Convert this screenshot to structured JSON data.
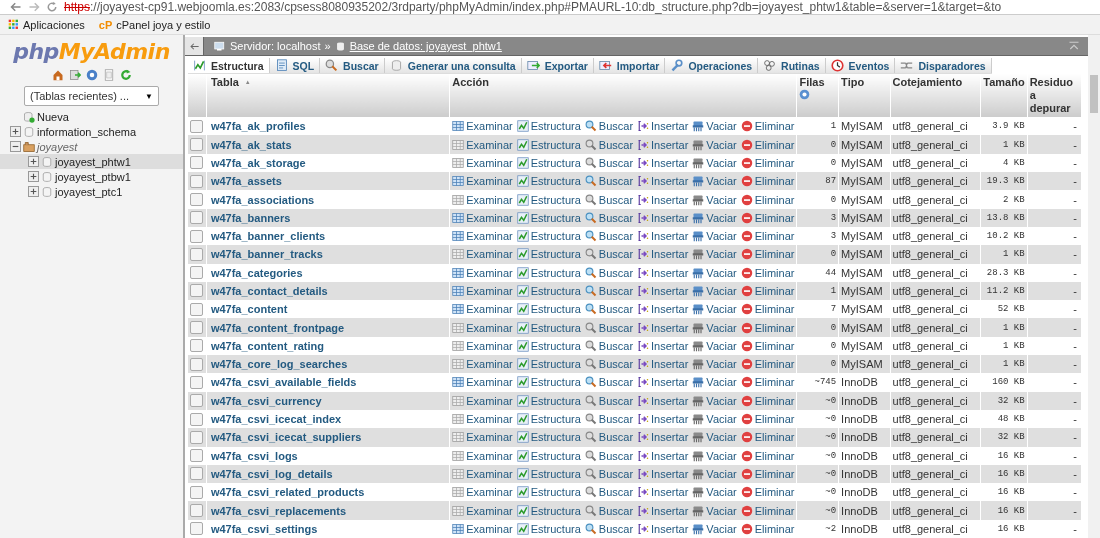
{
  "browser": {
    "url_scheme": "https",
    "url_rest": "://joyayest-cp91.webjoomla.es:2083/cpsess8080935202/3rdparty/phpMyAdmin/index.php#PMAURL-10:db_structure.php?db=joyayest_phtw1&table=&server=1&target=&to",
    "bookmarks": [
      {
        "kind": "apps",
        "label": "Aplicaciones"
      },
      {
        "kind": "cpanel",
        "badge": "cP",
        "label": "cPanel joya y estilo"
      }
    ]
  },
  "sidebar": {
    "logo_prefix": "php",
    "logo_name": "MyAdmin",
    "recent_tables": "(Tablas recientes) ...",
    "select_caret": "▼",
    "tree": [
      {
        "kind": "new",
        "label": "Nueva",
        "selected": false
      },
      {
        "kind": "db",
        "label": "information_schema",
        "expanded": false,
        "selected": false
      },
      {
        "kind": "group",
        "label": "joyayest",
        "expanded": true,
        "selected": false,
        "children": [
          {
            "kind": "db",
            "label": "joyayest_phtw1",
            "expanded": false,
            "selected": true
          },
          {
            "kind": "db",
            "label": "joyayest_ptbw1",
            "expanded": false,
            "selected": false
          },
          {
            "kind": "db",
            "label": "joyayest_ptc1",
            "expanded": false,
            "selected": false
          }
        ]
      }
    ]
  },
  "breadcrumb": {
    "server": "Servidor: localhost",
    "separator": "»",
    "database": "Base de datos: joyayest_phtw1"
  },
  "tabs": [
    {
      "label": "Estructura",
      "selected": true
    },
    {
      "label": "SQL",
      "selected": false
    },
    {
      "label": "Buscar",
      "selected": false
    },
    {
      "label": "Generar una consulta",
      "selected": false
    },
    {
      "label": "Exportar",
      "selected": false
    },
    {
      "label": "Importar",
      "selected": false
    },
    {
      "label": "Operaciones",
      "selected": false
    },
    {
      "label": "Rutinas",
      "selected": false
    },
    {
      "label": "Eventos",
      "selected": false
    },
    {
      "label": "Disparadores",
      "selected": false
    }
  ],
  "table": {
    "columns": [
      "Tabla",
      "Acción",
      "Filas",
      "Tipo",
      "Cotejamiento",
      "Tamaño",
      "Residuo a depurar"
    ],
    "sort_arrow": "▲",
    "rows": [
      {
        "name": "w47fa_ak_profiles",
        "checked": false,
        "empty": false,
        "actions": [
          "Examinar",
          "Estructura",
          "Buscar",
          "Insertar",
          "Vaciar",
          "Eliminar"
        ],
        "rows": "1",
        "type": "MyISAM",
        "collation": "utf8_general_ci",
        "size": "3.9 KB",
        "overhead": "-"
      },
      {
        "name": "w47fa_ak_stats",
        "checked": false,
        "empty": true,
        "actions": [
          "Examinar",
          "Estructura",
          "Buscar",
          "Insertar",
          "Vaciar",
          "Eliminar"
        ],
        "rows": "0",
        "type": "MyISAM",
        "collation": "utf8_general_ci",
        "size": "1 KB",
        "overhead": "-"
      },
      {
        "name": "w47fa_ak_storage",
        "checked": false,
        "empty": true,
        "actions": [
          "Examinar",
          "Estructura",
          "Buscar",
          "Insertar",
          "Vaciar",
          "Eliminar"
        ],
        "rows": "0",
        "type": "MyISAM",
        "collation": "utf8_general_ci",
        "size": "4 KB",
        "overhead": "-"
      },
      {
        "name": "w47fa_assets",
        "checked": false,
        "empty": false,
        "actions": [
          "Examinar",
          "Estructura",
          "Buscar",
          "Insertar",
          "Vaciar",
          "Eliminar"
        ],
        "rows": "87",
        "type": "MyISAM",
        "collation": "utf8_general_ci",
        "size": "19.3 KB",
        "overhead": "-"
      },
      {
        "name": "w47fa_associations",
        "checked": false,
        "empty": true,
        "actions": [
          "Examinar",
          "Estructura",
          "Buscar",
          "Insertar",
          "Vaciar",
          "Eliminar"
        ],
        "rows": "0",
        "type": "MyISAM",
        "collation": "utf8_general_ci",
        "size": "2 KB",
        "overhead": "-"
      },
      {
        "name": "w47fa_banners",
        "checked": false,
        "empty": false,
        "actions": [
          "Examinar",
          "Estructura",
          "Buscar",
          "Insertar",
          "Vaciar",
          "Eliminar"
        ],
        "rows": "3",
        "type": "MyISAM",
        "collation": "utf8_general_ci",
        "size": "13.8 KB",
        "overhead": "-"
      },
      {
        "name": "w47fa_banner_clients",
        "checked": false,
        "empty": false,
        "actions": [
          "Examinar",
          "Estructura",
          "Buscar",
          "Insertar",
          "Vaciar",
          "Eliminar"
        ],
        "rows": "3",
        "type": "MyISAM",
        "collation": "utf8_general_ci",
        "size": "10.2 KB",
        "overhead": "-"
      },
      {
        "name": "w47fa_banner_tracks",
        "checked": false,
        "empty": true,
        "actions": [
          "Examinar",
          "Estructura",
          "Buscar",
          "Insertar",
          "Vaciar",
          "Eliminar"
        ],
        "rows": "0",
        "type": "MyISAM",
        "collation": "utf8_general_ci",
        "size": "1 KB",
        "overhead": "-"
      },
      {
        "name": "w47fa_categories",
        "checked": false,
        "empty": false,
        "actions": [
          "Examinar",
          "Estructura",
          "Buscar",
          "Insertar",
          "Vaciar",
          "Eliminar"
        ],
        "rows": "44",
        "type": "MyISAM",
        "collation": "utf8_general_ci",
        "size": "28.3 KB",
        "overhead": "-"
      },
      {
        "name": "w47fa_contact_details",
        "checked": false,
        "empty": false,
        "actions": [
          "Examinar",
          "Estructura",
          "Buscar",
          "Insertar",
          "Vaciar",
          "Eliminar"
        ],
        "rows": "1",
        "type": "MyISAM",
        "collation": "utf8_general_ci",
        "size": "11.2 KB",
        "overhead": "-"
      },
      {
        "name": "w47fa_content",
        "checked": false,
        "empty": false,
        "actions": [
          "Examinar",
          "Estructura",
          "Buscar",
          "Insertar",
          "Vaciar",
          "Eliminar"
        ],
        "rows": "7",
        "type": "MyISAM",
        "collation": "utf8_general_ci",
        "size": "52 KB",
        "overhead": "-"
      },
      {
        "name": "w47fa_content_frontpage",
        "checked": false,
        "empty": true,
        "actions": [
          "Examinar",
          "Estructura",
          "Buscar",
          "Insertar",
          "Vaciar",
          "Eliminar"
        ],
        "rows": "0",
        "type": "MyISAM",
        "collation": "utf8_general_ci",
        "size": "1 KB",
        "overhead": "-"
      },
      {
        "name": "w47fa_content_rating",
        "checked": false,
        "empty": true,
        "actions": [
          "Examinar",
          "Estructura",
          "Buscar",
          "Insertar",
          "Vaciar",
          "Eliminar"
        ],
        "rows": "0",
        "type": "MyISAM",
        "collation": "utf8_general_ci",
        "size": "1 KB",
        "overhead": "-"
      },
      {
        "name": "w47fa_core_log_searches",
        "checked": false,
        "empty": true,
        "actions": [
          "Examinar",
          "Estructura",
          "Buscar",
          "Insertar",
          "Vaciar",
          "Eliminar"
        ],
        "rows": "0",
        "type": "MyISAM",
        "collation": "utf8_general_ci",
        "size": "1 KB",
        "overhead": "-"
      },
      {
        "name": "w47fa_csvi_available_fields",
        "checked": false,
        "empty": false,
        "actions": [
          "Examinar",
          "Estructura",
          "Buscar",
          "Insertar",
          "Vaciar",
          "Eliminar"
        ],
        "rows": "~745",
        "type": "InnoDB",
        "collation": "utf8_general_ci",
        "size": "160 KB",
        "overhead": "-"
      },
      {
        "name": "w47fa_csvi_currency",
        "checked": false,
        "empty": true,
        "actions": [
          "Examinar",
          "Estructura",
          "Buscar",
          "Insertar",
          "Vaciar",
          "Eliminar"
        ],
        "rows": "~0",
        "type": "InnoDB",
        "collation": "utf8_general_ci",
        "size": "32 KB",
        "overhead": "-"
      },
      {
        "name": "w47fa_csvi_icecat_index",
        "checked": false,
        "empty": true,
        "actions": [
          "Examinar",
          "Estructura",
          "Buscar",
          "Insertar",
          "Vaciar",
          "Eliminar"
        ],
        "rows": "~0",
        "type": "InnoDB",
        "collation": "utf8_general_ci",
        "size": "48 KB",
        "overhead": "-"
      },
      {
        "name": "w47fa_csvi_icecat_suppliers",
        "checked": false,
        "empty": true,
        "actions": [
          "Examinar",
          "Estructura",
          "Buscar",
          "Insertar",
          "Vaciar",
          "Eliminar"
        ],
        "rows": "~0",
        "type": "InnoDB",
        "collation": "utf8_general_ci",
        "size": "32 KB",
        "overhead": "-"
      },
      {
        "name": "w47fa_csvi_logs",
        "checked": false,
        "empty": true,
        "actions": [
          "Examinar",
          "Estructura",
          "Buscar",
          "Insertar",
          "Vaciar",
          "Eliminar"
        ],
        "rows": "~0",
        "type": "InnoDB",
        "collation": "utf8_general_ci",
        "size": "16 KB",
        "overhead": "-"
      },
      {
        "name": "w47fa_csvi_log_details",
        "checked": false,
        "empty": true,
        "actions": [
          "Examinar",
          "Estructura",
          "Buscar",
          "Insertar",
          "Vaciar",
          "Eliminar"
        ],
        "rows": "~0",
        "type": "InnoDB",
        "collation": "utf8_general_ci",
        "size": "16 KB",
        "overhead": "-"
      },
      {
        "name": "w47fa_csvi_related_products",
        "checked": false,
        "empty": true,
        "actions": [
          "Examinar",
          "Estructura",
          "Buscar",
          "Insertar",
          "Vaciar",
          "Eliminar"
        ],
        "rows": "~0",
        "type": "InnoDB",
        "collation": "utf8_general_ci",
        "size": "16 KB",
        "overhead": "-"
      },
      {
        "name": "w47fa_csvi_replacements",
        "checked": false,
        "empty": true,
        "actions": [
          "Examinar",
          "Estructura",
          "Buscar",
          "Insertar",
          "Vaciar",
          "Eliminar"
        ],
        "rows": "~0",
        "type": "InnoDB",
        "collation": "utf8_general_ci",
        "size": "16 KB",
        "overhead": "-"
      },
      {
        "name": "w47fa_csvi_settings",
        "checked": false,
        "empty": false,
        "actions": [
          "Examinar",
          "Estructura",
          "Buscar",
          "Insertar",
          "Vaciar",
          "Eliminar"
        ],
        "rows": "~2",
        "type": "InnoDB",
        "collation": "utf8_general_ci",
        "size": "16 KB",
        "overhead": "-"
      }
    ]
  }
}
